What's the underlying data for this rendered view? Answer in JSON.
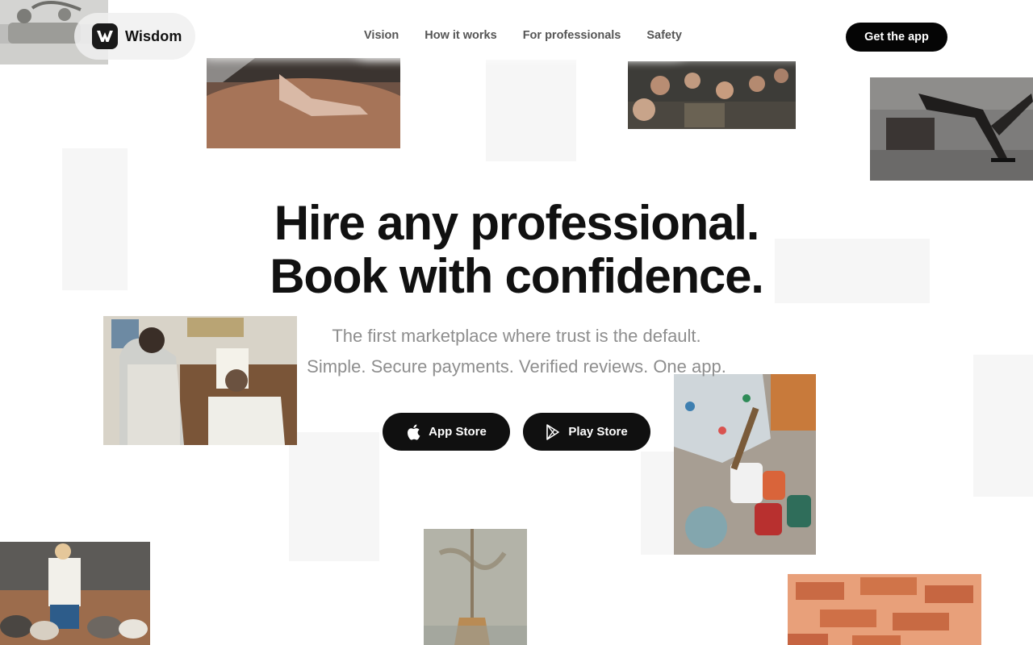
{
  "brand": {
    "name": "Wisdom",
    "logo_icon": "wisdom-w-logo-icon"
  },
  "nav": {
    "links": [
      {
        "label": "Vision"
      },
      {
        "label": "How it works"
      },
      {
        "label": "For professionals"
      },
      {
        "label": "Safety"
      }
    ],
    "cta_label": "Get the app"
  },
  "hero": {
    "title_line1": "Hire any professional.",
    "title_line2": "Book with confidence.",
    "subtitle_line1": "The first marketplace where trust is the default.",
    "subtitle_line2": "Simple. Secure payments. Verified reviews. One app."
  },
  "store_buttons": {
    "app_store": {
      "label": "App Store",
      "icon": "apple-icon"
    },
    "play_store": {
      "label": "Play Store",
      "icon": "play-store-icon"
    }
  },
  "colors": {
    "primary_button": "#050505",
    "title_text": "#111111",
    "subtitle_text": "#8e8e8e",
    "placeholder": "#f6f6f6"
  }
}
